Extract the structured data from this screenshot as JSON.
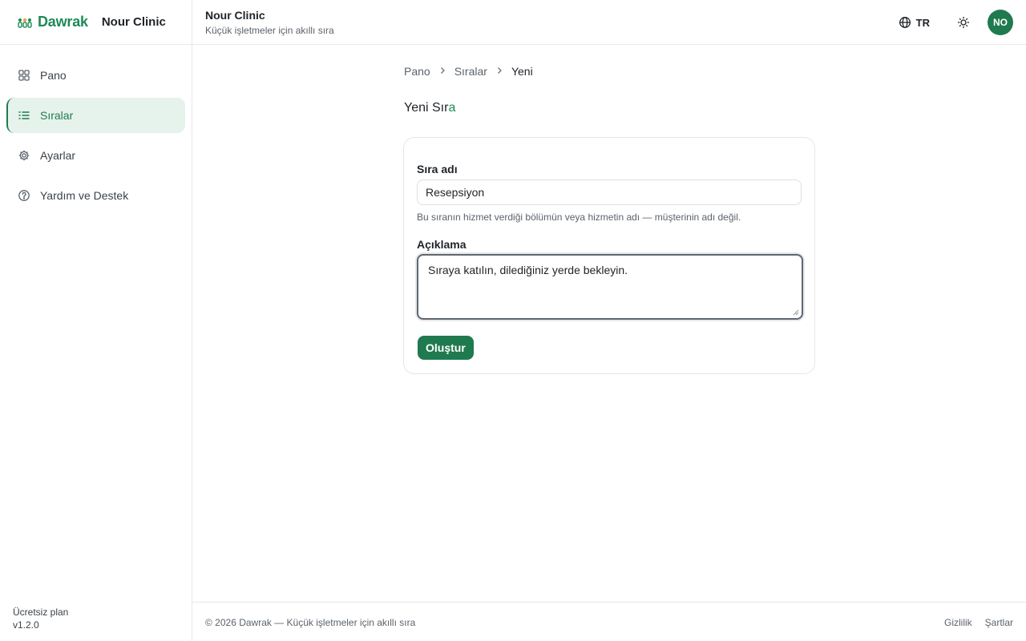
{
  "brand": {
    "logo_text": "Dawrak",
    "clinic_name": "Nour Clinic",
    "accent_color": "#1f8a57"
  },
  "sidebar": {
    "items": [
      {
        "label": "Pano",
        "icon": "dashboard-icon"
      },
      {
        "label": "Sıralar",
        "icon": "list-icon",
        "active": true
      },
      {
        "label": "Ayarlar",
        "icon": "gear-icon"
      },
      {
        "label": "Yardım ve Destek",
        "icon": "help-icon"
      }
    ],
    "plan": "Ücretsiz plan",
    "version": "v1.2.0"
  },
  "header": {
    "title": "Nour Clinic",
    "subtitle": "Küçük işletmeler için akıllı sıra",
    "language": "TR",
    "avatar_initials": "NO"
  },
  "breadcrumb": [
    "Pano",
    "Sıralar",
    "Yeni"
  ],
  "page": {
    "title_main": "Yeni Sır",
    "title_accent": "a"
  },
  "form": {
    "name_label": "Sıra adı",
    "name_value": "Resepsiyon",
    "name_hint": "Bu sıranın hizmet verdiği bölümün veya hizmetin adı — müşterinin adı değil.",
    "description_label": "Açıklama",
    "description_value": "Sıraya katılın, dilediğiniz yerde bekleyin.",
    "submit_label": "Oluştur"
  },
  "footer": {
    "copyright": "© 2026 Dawrak — Küçük işletmeler için akıllı sıra",
    "links": [
      "Gizlilik",
      "Şartlar"
    ]
  }
}
